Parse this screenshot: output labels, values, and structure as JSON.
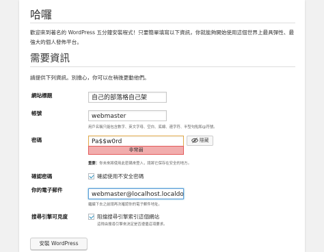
{
  "page": {
    "title": "哈囉",
    "intro": "歡迎來到著名的 WordPress 五分鐘安裝程式！只要簡單填寫以下資訊，你就能夠開始使用這個世界上最具彈性、最強大的個人發佈平台。",
    "section_title": "需要資訊",
    "lead": "請提供下列資訊。別擔心，你可以在稍後更動他們。"
  },
  "form": {
    "site_title": {
      "label": "網站標題",
      "value": "自己的部落格自己架"
    },
    "username": {
      "label": "帳號",
      "value": "webmaster",
      "note": "用戶名稱只能包含數字、英文字母、空白、底線、連字符、半型句點和@符號。"
    },
    "password": {
      "label": "密碼",
      "value": "Pa$$w0rd",
      "strength": "非常弱",
      "hide_label": "隱藏",
      "note_strong": "重要：",
      "note": "你未來將使用此密碼來登入，請將它保存在安全的地方。"
    },
    "confirm_weak": {
      "label": "確認密碼",
      "checkbox_label": "確認使用不安全密碼"
    },
    "email": {
      "label": "你的電子郵件",
      "value": "webmaster@localhost.localdo",
      "note": "繼續下去之前請再次確認你的電子郵件地址。"
    },
    "search_visibility": {
      "label": "搜尋引擎可見度",
      "checkbox_label": "阻擋搜尋引擎索引這個網站",
      "note": "這得由搜尋引擎來決定是否遵循這項要求。"
    },
    "submit_label": "安裝 WordPress"
  }
}
